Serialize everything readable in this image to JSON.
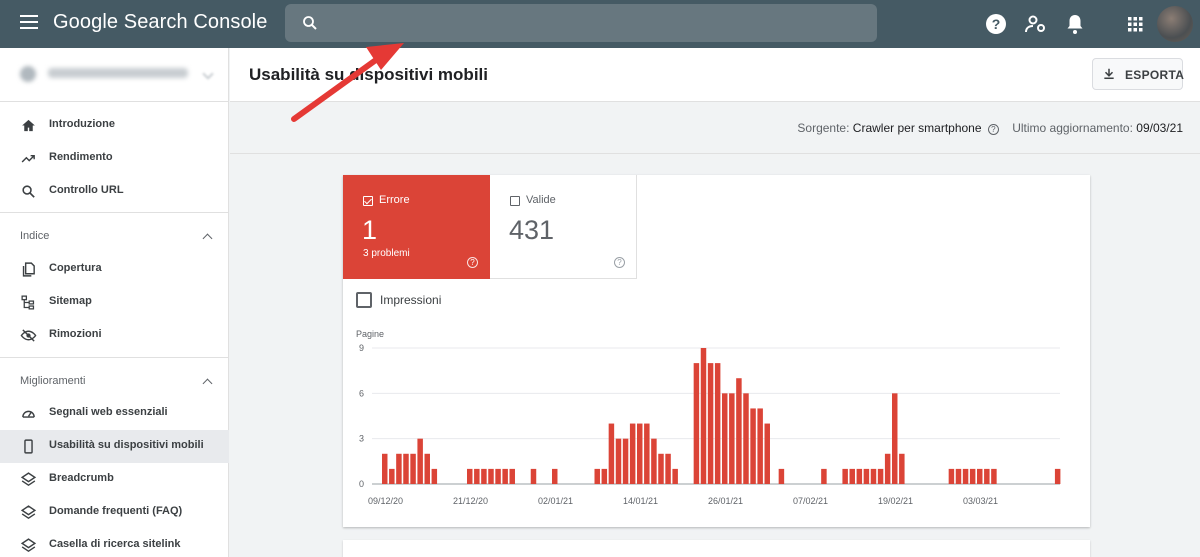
{
  "app": {
    "title": "Google Search Console"
  },
  "search": {
    "placeholder": ""
  },
  "header": {
    "title": "Usabilità su dispositivi mobili",
    "export_label": "ESPORTA"
  },
  "subbar": {
    "source_label": "Sorgente:",
    "source_value": "Crawler per smartphone",
    "updated_label": "Ultimo aggiornamento:",
    "updated_value": "09/03/21"
  },
  "sidebar": {
    "top_items": [
      {
        "label": "Introduzione",
        "icon": "home-icon"
      },
      {
        "label": "Rendimento",
        "icon": "trending-up-icon"
      },
      {
        "label": "Controllo URL",
        "icon": "search-icon"
      }
    ],
    "sections": [
      {
        "title": "Indice",
        "items": [
          {
            "label": "Copertura",
            "icon": "file-copy-icon"
          },
          {
            "label": "Sitemap",
            "icon": "sitemap-icon"
          },
          {
            "label": "Rimozioni",
            "icon": "eye-off-icon"
          }
        ]
      },
      {
        "title": "Miglioramenti",
        "items": [
          {
            "label": "Segnali web essenziali",
            "icon": "speed-gauge-icon"
          },
          {
            "label": "Usabilità su dispositivi mobili",
            "icon": "smartphone-icon",
            "active": true
          },
          {
            "label": "Breadcrumb",
            "icon": "layers-icon"
          },
          {
            "label": "Domande frequenti (FAQ)",
            "icon": "layers-icon"
          },
          {
            "label": "Casella di ricerca sitelink",
            "icon": "layers-icon"
          }
        ]
      }
    ]
  },
  "tiles": {
    "error": {
      "label": "Errore",
      "value": "1",
      "sub": "3 problemi",
      "checked": true,
      "color": "#db4437"
    },
    "valid": {
      "label": "Valide",
      "value": "431",
      "checked": false
    }
  },
  "impressions": {
    "label": "Impressioni",
    "checked": false
  },
  "chart_data": {
    "type": "bar",
    "ylabel": "Pagine",
    "ylim": [
      0,
      9
    ],
    "yticks": [
      0,
      3,
      6,
      9
    ],
    "grid": true,
    "color": "#db4437",
    "x_tick_labels": [
      "09/12/20",
      "21/12/20",
      "02/01/21",
      "14/01/21",
      "26/01/21",
      "07/02/21",
      "19/02/21",
      "03/03/21"
    ],
    "start": "09/12/20",
    "values": [
      2,
      1,
      2,
      2,
      2,
      3,
      2,
      1,
      0,
      0,
      0,
      0,
      1,
      1,
      1,
      1,
      1,
      1,
      1,
      0,
      0,
      1,
      0,
      0,
      1,
      0,
      0,
      0,
      0,
      0,
      1,
      1,
      4,
      3,
      3,
      4,
      4,
      4,
      3,
      2,
      2,
      1,
      0,
      0,
      8,
      9,
      8,
      8,
      6,
      6,
      7,
      6,
      5,
      5,
      4,
      0,
      1,
      0,
      0,
      0,
      0,
      0,
      1,
      0,
      0,
      1,
      1,
      1,
      1,
      1,
      1,
      2,
      6,
      2,
      0,
      0,
      0,
      0,
      0,
      0,
      1,
      1,
      1,
      1,
      1,
      1,
      1,
      0,
      0,
      0,
      0,
      0,
      0,
      0,
      0,
      1
    ]
  }
}
